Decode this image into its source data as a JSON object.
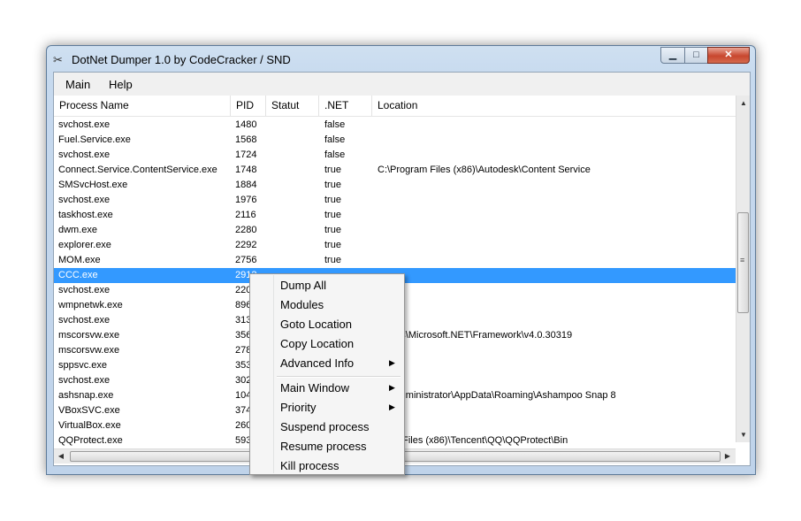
{
  "window": {
    "title": "DotNet Dumper 1.0 by CodeCracker / SND",
    "buttons": {
      "minimize": "▁",
      "maximize": "□",
      "close": "✕"
    }
  },
  "menubar": {
    "items": [
      "Main",
      "Help"
    ]
  },
  "listview": {
    "columns": [
      "Process Name",
      "PID",
      "Statut",
      ".NET",
      "Location"
    ],
    "rows": [
      {
        "name": "svchost.exe",
        "pid": "1480",
        "statut": "",
        "net": "false",
        "location": ""
      },
      {
        "name": "Fuel.Service.exe",
        "pid": "1568",
        "statut": "",
        "net": "false",
        "location": ""
      },
      {
        "name": "svchost.exe",
        "pid": "1724",
        "statut": "",
        "net": "false",
        "location": ""
      },
      {
        "name": "Connect.Service.ContentService.exe",
        "pid": "1748",
        "statut": "",
        "net": "true",
        "location": "C:\\Program Files (x86)\\Autodesk\\Content Service"
      },
      {
        "name": "SMSvcHost.exe",
        "pid": "1884",
        "statut": "",
        "net": "true",
        "location": ""
      },
      {
        "name": "svchost.exe",
        "pid": "1976",
        "statut": "",
        "net": "true",
        "location": ""
      },
      {
        "name": "taskhost.exe",
        "pid": "2116",
        "statut": "",
        "net": "true",
        "location": ""
      },
      {
        "name": "dwm.exe",
        "pid": "2280",
        "statut": "",
        "net": "true",
        "location": ""
      },
      {
        "name": "explorer.exe",
        "pid": "2292",
        "statut": "",
        "net": "true",
        "location": ""
      },
      {
        "name": "MOM.exe",
        "pid": "2756",
        "statut": "",
        "net": "true",
        "location": ""
      },
      {
        "name": "CCC.exe",
        "pid": "2912",
        "statut": "",
        "net": "",
        "location": "",
        "selected": true
      },
      {
        "name": "svchost.exe",
        "pid": "220",
        "statut": "",
        "net": "",
        "location": ""
      },
      {
        "name": "wmpnetwk.exe",
        "pid": "896",
        "statut": "",
        "net": "",
        "location": ""
      },
      {
        "name": "svchost.exe",
        "pid": "313",
        "statut": "",
        "net": "",
        "location": ""
      },
      {
        "name": "mscorsvw.exe",
        "pid": "356",
        "statut": "",
        "net": "",
        "location": "ndows\\Microsoft.NET\\Framework\\v4.0.30319"
      },
      {
        "name": "mscorsvw.exe",
        "pid": "278",
        "statut": "",
        "net": "",
        "location": ""
      },
      {
        "name": "sppsvc.exe",
        "pid": "353",
        "statut": "",
        "net": "",
        "location": ""
      },
      {
        "name": "svchost.exe",
        "pid": "302",
        "statut": "",
        "net": "",
        "location": ""
      },
      {
        "name": "ashsnap.exe",
        "pid": "104",
        "statut": "",
        "net": "",
        "location": "ers\\Administrator\\AppData\\Roaming\\Ashampoo Snap 8"
      },
      {
        "name": "VBoxSVC.exe",
        "pid": "374",
        "statut": "",
        "net": "",
        "location": ""
      },
      {
        "name": "VirtualBox.exe",
        "pid": "260",
        "statut": "",
        "net": "",
        "location": ""
      },
      {
        "name": "QQProtect.exe",
        "pid": "593",
        "statut": "",
        "net": "",
        "location": "gram Files (x86)\\Tencent\\QQ\\QQProtect\\Bin"
      }
    ]
  },
  "scrollbars": {
    "vertical": {
      "up_icon": "▲",
      "down_icon": "▼",
      "grip_icon": "≡"
    },
    "horizontal": {
      "left_icon": "◀",
      "right_icon": "▶"
    }
  },
  "context_menu": {
    "groups": [
      [
        {
          "label": "Dump All",
          "submenu": false
        },
        {
          "label": "Modules",
          "submenu": false
        },
        {
          "label": "Goto Location",
          "submenu": false
        },
        {
          "label": "Copy Location",
          "submenu": false
        },
        {
          "label": "Advanced Info",
          "submenu": true
        }
      ],
      [
        {
          "label": "Main Window",
          "submenu": true
        },
        {
          "label": "Priority",
          "submenu": true
        },
        {
          "label": "Suspend process",
          "submenu": false
        },
        {
          "label": "Resume process",
          "submenu": false
        },
        {
          "label": "Kill process",
          "submenu": false
        }
      ]
    ],
    "submenu_arrow": "▶"
  },
  "colors": {
    "selection": "#3399ff",
    "window_frame": "#c6d9ee",
    "close_button": "#c8462e"
  }
}
